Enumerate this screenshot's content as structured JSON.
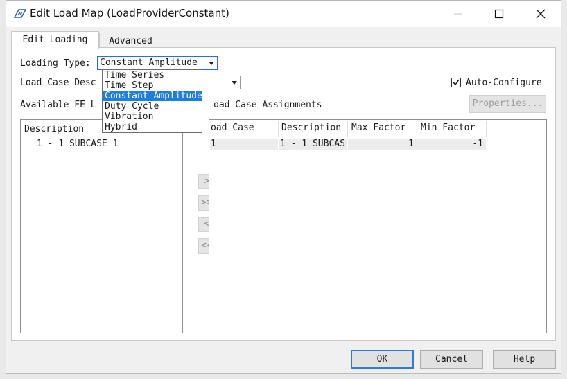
{
  "window": {
    "title": "Edit Load Map (LoadProviderConstant)",
    "icons": {
      "app": "app-logo-icon",
      "minimize": "minimize-icon",
      "maximize": "maximize-icon",
      "close": "close-icon"
    }
  },
  "tabs": [
    {
      "label": "Edit Loading",
      "active": true
    },
    {
      "label": "Advanced",
      "active": false
    }
  ],
  "form": {
    "loading_type_label": "Loading Type:",
    "loading_type_value": "Constant Amplitude",
    "load_case_desc_label": "Load Case Desc",
    "auto_configure_label": "Auto-Configure",
    "auto_configure_checked": true,
    "available_label": "Available FE L",
    "assignments_label": "oad Case Assignments",
    "properties_button": "Properties..."
  },
  "dropdown_options": [
    "Time Series",
    "Time Step",
    "Constant Amplitude",
    "Duty Cycle",
    "Vibration",
    "Hybrid"
  ],
  "dropdown_selected_index": 2,
  "available_list": {
    "header": "Description",
    "items": [
      "1 - 1 SUBCASE 1"
    ]
  },
  "transfer_buttons": [
    ">",
    ">>",
    "<",
    "<<"
  ],
  "assignments_table": {
    "headers": [
      "oad Case",
      "Description",
      "Max Factor",
      "Min Factor"
    ],
    "rows": [
      [
        "1",
        "1 - 1 SUBCAS",
        "1",
        "-1"
      ]
    ]
  },
  "footer": {
    "ok": "OK",
    "cancel": "Cancel",
    "help": "Help"
  },
  "colors": {
    "accent": "#1e7ee0",
    "focus_border": "#2b6cd8",
    "window_bg": "#f0f0f0"
  }
}
